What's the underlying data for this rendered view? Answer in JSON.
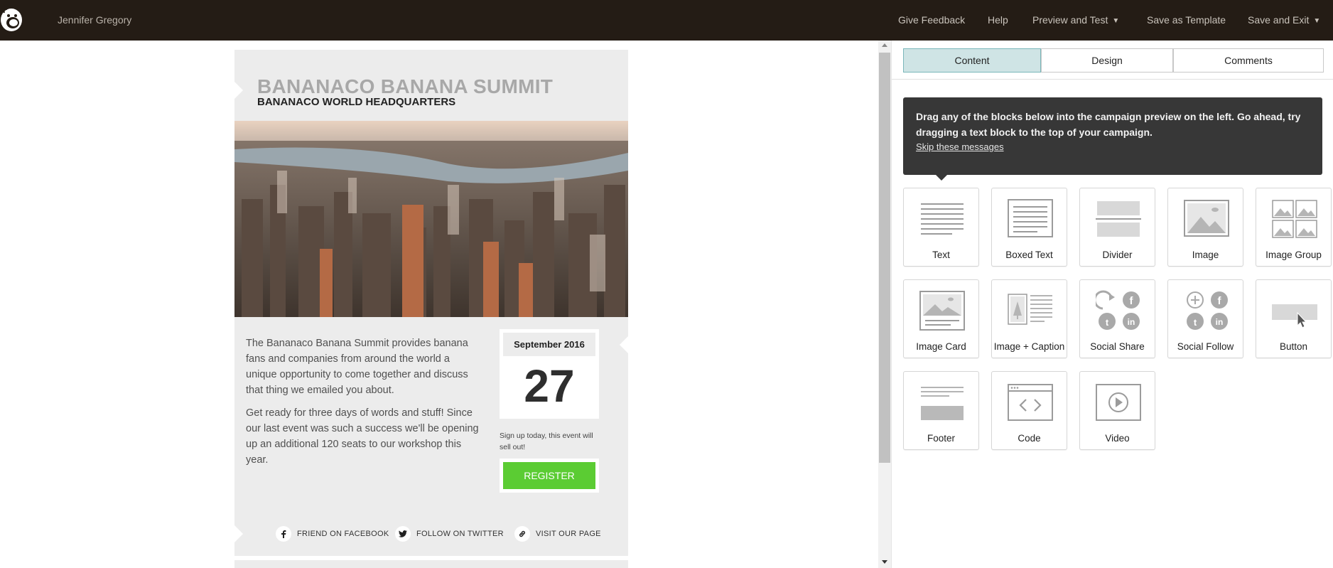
{
  "topbar": {
    "user_name": "Jennifer Gregory",
    "give_feedback": "Give Feedback",
    "help": "Help",
    "preview_and_test": "Preview and Test",
    "save_as_template": "Save as Template",
    "save_and_exit": "Save and Exit",
    "background_color": "#241c15"
  },
  "email": {
    "title": "BANANACO BANANA SUMMIT",
    "subtitle": "BANANACO WORLD HEADQUARTERS",
    "paragraphs": [
      "The Bananaco Banana Summit provides banana fans and companies from around the world a unique opportunity to come together and discuss that thing we emailed you about.",
      "Get ready for three days of words and stuff! Since our last event was such a success we'll be opening up an additional 120 seats to our workshop this year."
    ],
    "date_month": "September 2016",
    "date_day": "27",
    "signup_note": "Sign up today, this event will sell out!",
    "register_label": "REGISTER",
    "register_color": "#5bcc33",
    "social": {
      "facebook": "FRIEND ON FACEBOOK",
      "twitter": "FOLLOW ON TWITTER",
      "page": "VISIT OUR PAGE"
    }
  },
  "panel": {
    "tabs": [
      "Content",
      "Design",
      "Comments"
    ],
    "active_tab": "Content",
    "tip_text": "Drag any of the blocks below into the campaign preview on the left. Go ahead, try dragging a text block to the top of your campaign.",
    "tip_link": "Skip these messages",
    "blocks": [
      "Text",
      "Boxed Text",
      "Divider",
      "Image",
      "Image Group",
      "Image Card",
      "Image + Caption",
      "Social Share",
      "Social Follow",
      "Button",
      "Footer",
      "Code",
      "Video"
    ]
  }
}
